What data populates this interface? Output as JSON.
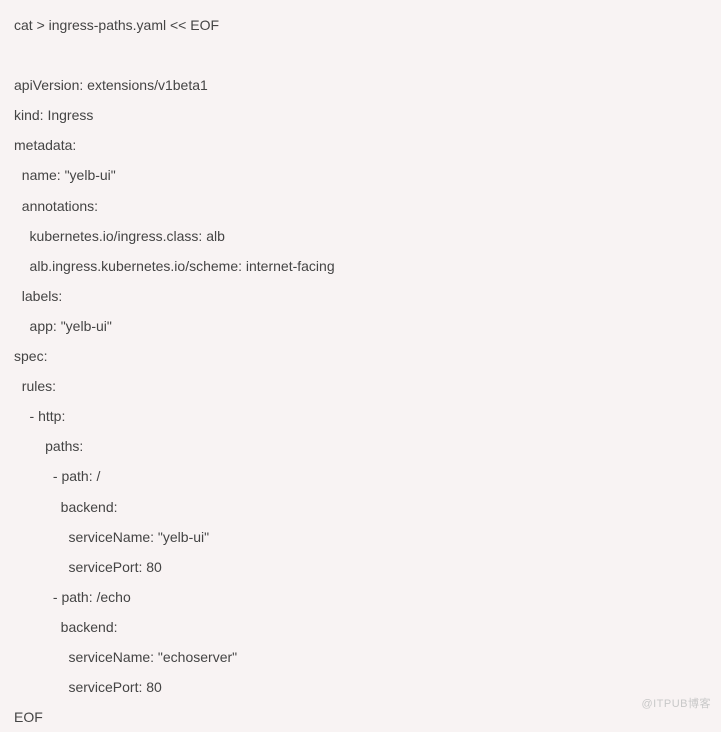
{
  "code": {
    "lines": [
      "cat > ingress-paths.yaml << EOF",
      "",
      "apiVersion: extensions/v1beta1",
      "kind: Ingress",
      "metadata:",
      "  name: \"yelb-ui\"",
      "  annotations:",
      "    kubernetes.io/ingress.class: alb",
      "    alb.ingress.kubernetes.io/scheme: internet-facing",
      "  labels:",
      "    app: \"yelb-ui\"",
      "spec:",
      "  rules:",
      "    - http:",
      "        paths:",
      "          - path: /",
      "            backend:",
      "              serviceName: \"yelb-ui\"",
      "              servicePort: 80",
      "          - path: /echo",
      "            backend:",
      "              serviceName: \"echoserver\"",
      "              servicePort: 80",
      "EOF"
    ]
  },
  "watermark": "@ITPUB博客"
}
